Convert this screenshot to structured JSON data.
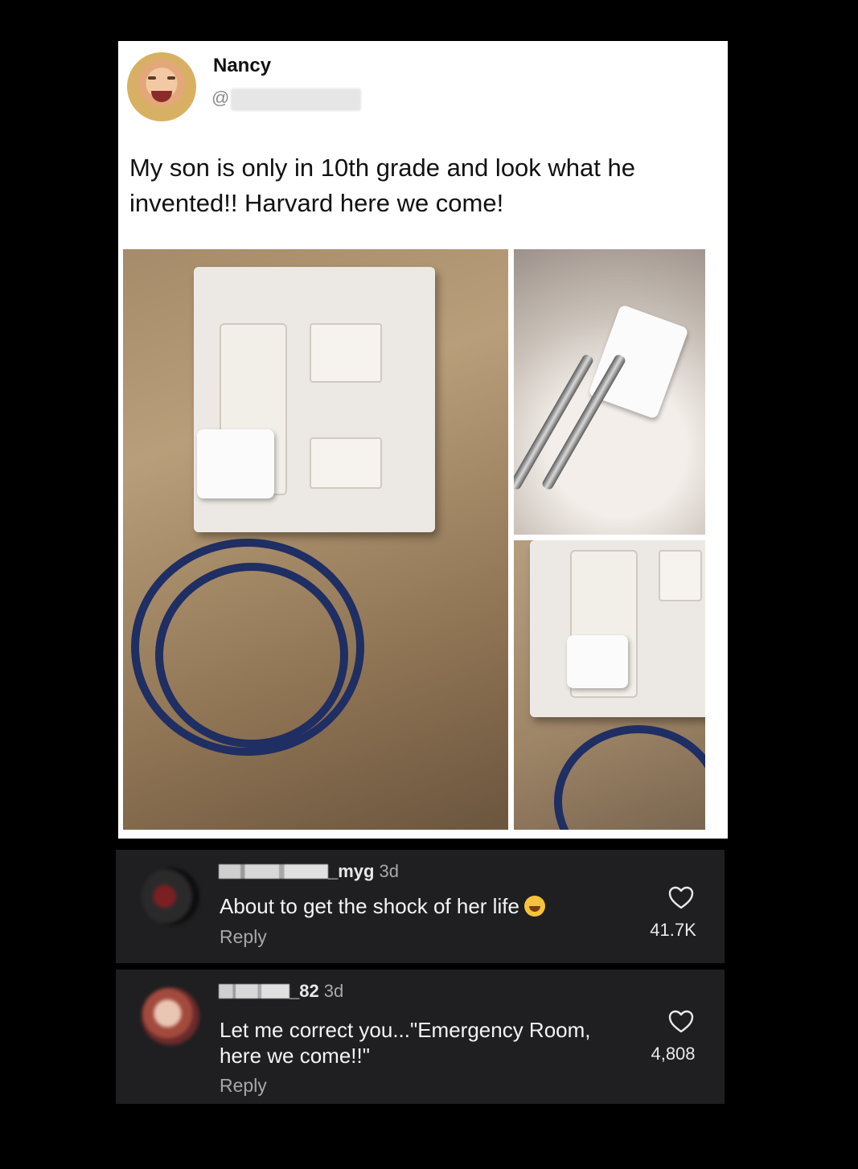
{
  "post": {
    "author_name": "Nancy",
    "handle_prefix": "@",
    "text": "My son is only in 10th grade and look what he invented!! Harvard here we come!"
  },
  "comments": [
    {
      "username_suffix": "_myg",
      "time": "3d",
      "text": "About to get the shock of her life",
      "emoji": "face-with-tears-of-joy",
      "reply_label": "Reply",
      "likes": "41.7K"
    },
    {
      "username_suffix": "_82",
      "time": "3d",
      "text": "Let me correct you...\"Emergency Room, here we come!!\"",
      "reply_label": "Reply",
      "likes": "4,808"
    }
  ],
  "icons": {
    "like": "heart-icon"
  },
  "colors": {
    "page_background": "#000000",
    "comment_background": "#1f1f21",
    "post_background": "#ffffff"
  }
}
